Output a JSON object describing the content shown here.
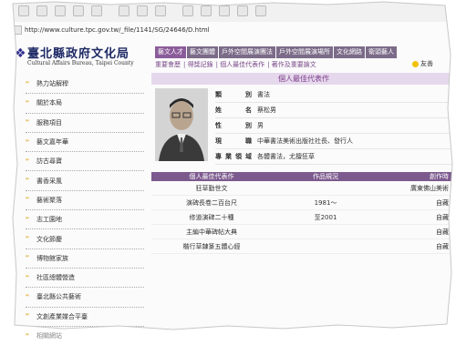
{
  "address": "http://www.culture.tpc.gov.tw/_file/1141/SG/24646/D.html",
  "logo": {
    "zh": "臺北縣政府文化局",
    "en": "Cultural Affairs Bureau, Taipei County"
  },
  "tabs": [
    "藝文人才",
    "藝文團體",
    "戶外空間展演團法",
    "戶外空間展演場所",
    "文化網路",
    "衛頭藝人"
  ],
  "subnav": [
    "重要會歷",
    "得獎記錄",
    "個人最佳代表作",
    "著作及重要論文"
  ],
  "corner_label": "友善",
  "sidebar": [
    "熱力站解稈",
    "關於本局",
    "服務項目",
    "藝文嘉年華",
    "訪古尋寶",
    "書香采風",
    "藝術聚落",
    "志工園地",
    "文化節慶",
    "博物館家族",
    "社區總體營造",
    "臺北縣公共藝術",
    "文創產業媒合平臺",
    "相關網站"
  ],
  "section_title": "個人最佳代表作",
  "info": [
    {
      "k": "類別",
      "v": "書法"
    },
    {
      "k": "姓名",
      "v": "蔡松男"
    },
    {
      "k": "性別",
      "v": "男"
    },
    {
      "k": "現職",
      "v": "中華書法美術出版社社長、發行人"
    },
    {
      "k": "專業領域",
      "v": "各體書法，尤擅狂草"
    }
  ],
  "table": {
    "headers": [
      "個人最佳代表作",
      "作品規況",
      "創作時"
    ],
    "rows": [
      [
        "狂草勤世文",
        "",
        "廣東佛山美術"
      ],
      [
        "演碑長卷二百台尺",
        "1981～",
        "自藏"
      ],
      [
        "修道演碑二十種",
        "至2001",
        "自藏"
      ],
      [
        "主編中華碑帖大典",
        "",
        "自藏"
      ],
      [
        "楷行草隸篆五體心經",
        "",
        "自藏"
      ]
    ]
  }
}
